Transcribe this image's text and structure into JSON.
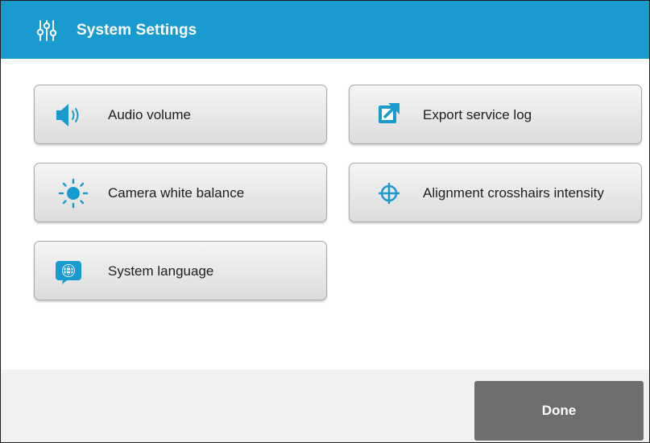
{
  "header": {
    "title": "System Settings",
    "icon": "sliders-icon"
  },
  "tiles": [
    {
      "label": "Audio volume",
      "icon": "speaker-volume-icon"
    },
    {
      "label": "Export service log",
      "icon": "export-arrow-icon"
    },
    {
      "label": "Camera white balance",
      "icon": "sun-icon"
    },
    {
      "label": "Alignment crosshairs intensity",
      "icon": "crosshairs-icon"
    },
    {
      "label": "System language",
      "icon": "globe-speech-icon"
    }
  ],
  "footer": {
    "done_label": "Done"
  },
  "colors": {
    "header_bg": "#1a9bd0",
    "icon_blue": "#1a9bd0",
    "done_bg": "#6e6e6e",
    "footer_bg": "#f1f1f1"
  }
}
